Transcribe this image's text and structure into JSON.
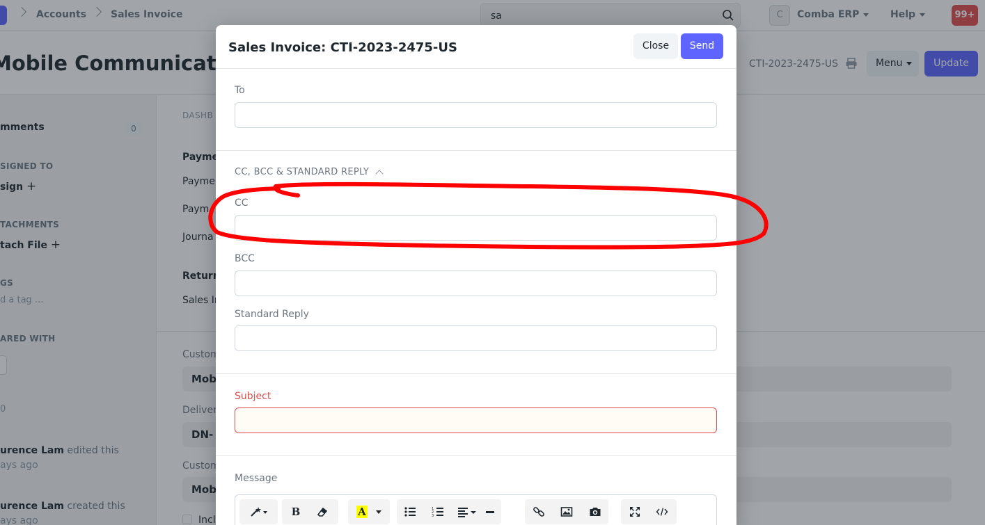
{
  "navbar": {
    "breadcrumbs": [
      "Accounts",
      "Sales Invoice"
    ],
    "search_value": "sa",
    "avatar_letter": "C",
    "company_label": "Comba ERP",
    "help_label": "Help",
    "notifications_badge": "99+"
  },
  "page": {
    "title": "Mobile Communications",
    "doc_name": "CTI-2023-2475-US",
    "menu_label": "Menu",
    "update_label": "Update"
  },
  "sidebar": {
    "comments_label": "mments",
    "comments_count": "0",
    "assigned_to_head": "SIGNED TO",
    "assign_label": "sign",
    "attachments_head": "TACHMENTS",
    "attach_label": "tach File",
    "tags_head": "GS",
    "tag_placeholder": "d a tag ...",
    "shared_head": "ARED WITH",
    "zero_label": "0",
    "activity": [
      {
        "user": "urence Lam",
        "action": " edited this",
        "time": "ays ago"
      },
      {
        "user": "urence Lam",
        "action": " created this",
        "time": "ays ago"
      }
    ]
  },
  "main": {
    "dashboard_head": "DASHB",
    "payment_head": "Payme",
    "payment_links": [
      "Paymen",
      "Paym",
      "Journa"
    ],
    "returns_head": "Return",
    "returns_links": [
      "Sales In"
    ],
    "customer_label": "Custom",
    "customer_value": "Mob",
    "delivery_label": "Deliver",
    "delivery_value": "DN-",
    "customer_label2": "Custom",
    "customer_value2": "Mob",
    "include_label": "Incl"
  },
  "modal": {
    "title": "Sales Invoice: CTI-2023-2475-US",
    "close_label": "Close",
    "send_label": "Send",
    "to_label": "To",
    "to_value": "",
    "section_label": "CC, BCC & STANDARD REPLY",
    "cc_label": "CC",
    "cc_value": "",
    "bcc_label": "BCC",
    "bcc_value": "",
    "standard_reply_label": "Standard Reply",
    "standard_reply_value": "",
    "subject_label": "Subject",
    "subject_value": "",
    "message_label": "Message",
    "toolbar_icons": [
      "magic-wand-icon",
      "bold-icon",
      "eraser-icon",
      "font-color-icon",
      "bullet-list-icon",
      "numbered-list-icon",
      "align-icon",
      "horizontal-rule-icon",
      "link-icon",
      "image-icon",
      "camera-icon",
      "fullscreen-icon",
      "code-view-icon"
    ]
  },
  "colors": {
    "primary": "#5e64ff",
    "danger": "#e24c4c",
    "annotation": "#ff0000"
  }
}
